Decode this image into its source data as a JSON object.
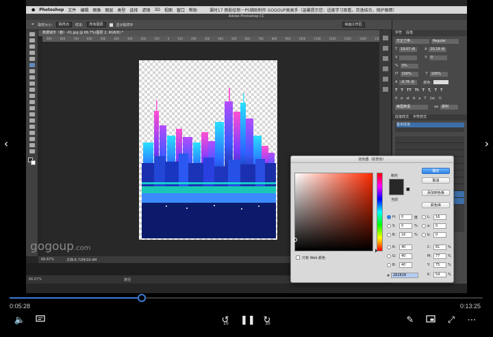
{
  "app": {
    "menu_items": [
      "Photoshop",
      "文件",
      "编辑",
      "图像",
      "图层",
      "类型",
      "选择",
      "滤镜",
      "3D",
      "视图",
      "窗口",
      "帮助"
    ],
    "menu_right_text": "课时17 倒影绘制－PS辅助制作    GOGOUP高高手（温馨提示您：适度学习观看，劳逸结合，保护眼睛）",
    "window_title": "Adobe Photoshop CC",
    "options": {
      "sample_size_label": "取样大小:",
      "sample_size_value": "取样点",
      "sample_label": "样本:",
      "sample_value": "所有图层",
      "show_ring_label": "显示取样环",
      "workspace": "绘画工作区"
    },
    "doc_tab": "数据城市（春）-01.jpg @ 66.7%(图层 2, RGB/8) *",
    "ruler_ticks": [
      "900",
      "800",
      "700",
      "600",
      "500",
      "400",
      "300",
      "200",
      "100",
      "0",
      "100",
      "200",
      "300",
      "400",
      "500",
      "600",
      "700",
      "800",
      "900",
      "1000",
      "1100",
      "1200",
      "1300",
      "1400",
      "1500",
      "1600",
      "1700",
      "1800",
      "1900",
      "2000",
      "2100",
      "2200",
      "2300",
      "2400",
      "2500",
      "2600",
      "2700",
      "2800",
      "2900",
      "3000",
      "3100",
      "3200"
    ],
    "status": {
      "zoom": "66.67%",
      "doc_size": "文档:6.72M/18.4M"
    },
    "bottom_label": "路径",
    "bottom_zoom": "66.67%"
  },
  "watermark": {
    "main": "gogoup",
    "suffix": ".com"
  },
  "right_panel": {
    "tabs": [
      "字符",
      "段落"
    ],
    "font_family": "方正兰亭...",
    "font_style": "Regular",
    "size_1": "19.07 点",
    "size_2": "20.18 点",
    "tracking": "0",
    "kerning": "0%",
    "scale_v": "100%",
    "scale_h": "100%",
    "baseline": "-0.76 点",
    "color_label": "颜色:",
    "lang": "美国英语",
    "aa": "犀利",
    "paragraph_tabs": [
      "段落样式",
      "字符样式"
    ],
    "basic": "基本段落"
  },
  "color_picker": {
    "title": "拾色器（前景色）",
    "new_label": "新的",
    "current_label": "当前",
    "ok": "确定",
    "cancel": "取消",
    "add_swatch": "添加到色板",
    "color_libraries": "颜色库",
    "h_label": "H:",
    "h_value": "0",
    "h_unit": "度",
    "s_label": "S:",
    "s_value": "0",
    "s_unit": "%",
    "b_label": "B:",
    "b_value": "16",
    "b_unit": "%",
    "r_label": "R:",
    "r_value": "40",
    "g_label": "G:",
    "g_value": "40",
    "bb_label": "B:",
    "bb_value": "40",
    "l_label": "L:",
    "l_value": "16",
    "a_label": "a:",
    "a_value": "0",
    "b2_label": "b:",
    "b2_value": "0",
    "c_label": "C:",
    "c_value": "81",
    "c_unit": "%",
    "m_label": "M:",
    "m_value": "77",
    "m_unit": "%",
    "y_label": "Y:",
    "y_value": "75",
    "y_unit": "%",
    "k_label": "K:",
    "k_value": "54",
    "k_unit": "%",
    "web_only_label": "只有 Web 颜色",
    "hex_label": "#",
    "hex_value": "282828",
    "current_color": "#282828"
  },
  "player": {
    "elapsed": "0:05:28",
    "duration": "0:13:25",
    "progress": 0.28,
    "skip_back_label": "10",
    "skip_fwd_label": "30"
  }
}
